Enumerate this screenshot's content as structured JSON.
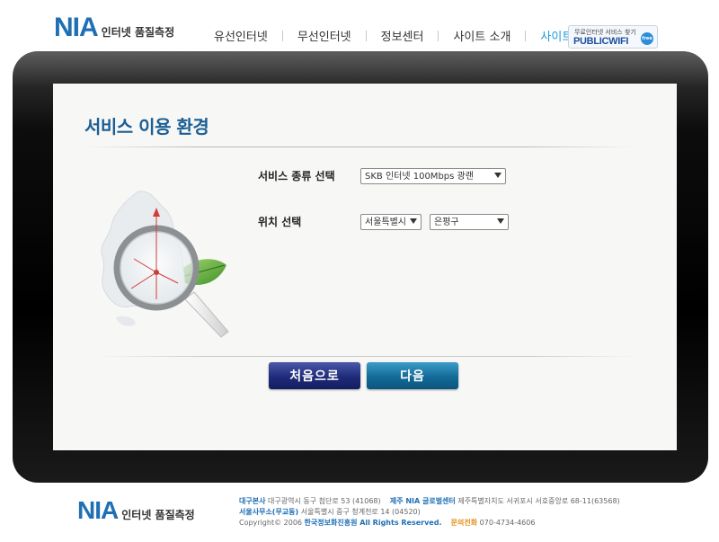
{
  "header": {
    "logo_mark": "NIA",
    "logo_text": "인터넷 품질측정",
    "nav": [
      {
        "label": "유선인터넷"
      },
      {
        "label": "무선인터넷"
      },
      {
        "label": "정보센터"
      },
      {
        "label": "사이트 소개"
      },
      {
        "label": "사이트맵"
      }
    ],
    "public_wifi": {
      "top": "무료인터넷 서비스 찾기",
      "main": "PUBLICWIFI",
      "badge": "free"
    }
  },
  "main": {
    "title": "서비스 이용 환경",
    "service_type_label": "서비스 종류 선택",
    "service_type_value": "SKB 인터넷 100Mbps 광랜",
    "location_label": "위치 선택",
    "location_city_value": "서울특별시",
    "location_district_value": "은평구",
    "buttons": {
      "first": "처음으로",
      "next": "다음"
    }
  },
  "footer": {
    "logo_mark": "NIA",
    "logo_text": "인터넷 품질측정",
    "hq_label": "대구본사",
    "hq_address": "대구광역시 동구 첨단로 53 (41068)",
    "jeju_label": "제주 NIA 글로벌센터",
    "jeju_address": "제주특별자치도 서귀포시 서호중앙로 68-11(63568)",
    "seoul_label": "서울사무소(무교동)",
    "seoul_address": "서울특별시 중구 청계천로 14 (04520)",
    "copyright_prefix": "Copyright© 2006",
    "copyright_org": "한국정보화진흥원 All Rights Reserved.",
    "phone_label": "문의전화",
    "phone": "070-4734-4606"
  },
  "colors": {
    "accent": "#1f6fb5",
    "active_nav": "#1e9ad6",
    "title": "#1b5f95",
    "btn_first": "#1f2b7a",
    "btn_next": "#136a97"
  }
}
